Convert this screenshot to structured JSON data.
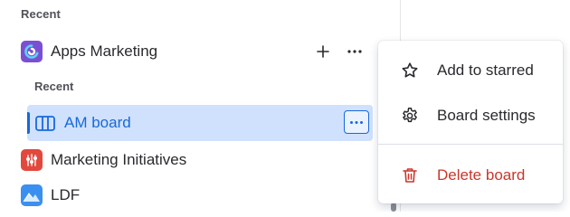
{
  "sidebar": {
    "recent_heading": "Recent",
    "spaces": [
      {
        "label": "Apps Marketing",
        "icon": "apps-marketing-space-icon",
        "icon_color": "#7b4fd3",
        "add_label": "+",
        "more_label": "···"
      },
      {
        "label": "Marketing Initiatives",
        "icon": "marketing-initiatives-space-icon",
        "icon_color": "#e2483d"
      },
      {
        "label": "LDF",
        "icon": "ldf-space-icon",
        "icon_color": "#3b8ff0"
      }
    ],
    "sub_heading": "Recent",
    "board": {
      "label": "AM board",
      "icon": "board-icon",
      "selected": true,
      "accent_color": "#1868db",
      "more_label": "···"
    }
  },
  "menu": {
    "items": [
      {
        "label": "Add to starred",
        "icon": "star-icon"
      },
      {
        "label": "Board settings",
        "icon": "gear-icon"
      },
      {
        "label": "Delete board",
        "icon": "trash-icon",
        "danger": true,
        "color": "#c9372c"
      }
    ]
  }
}
